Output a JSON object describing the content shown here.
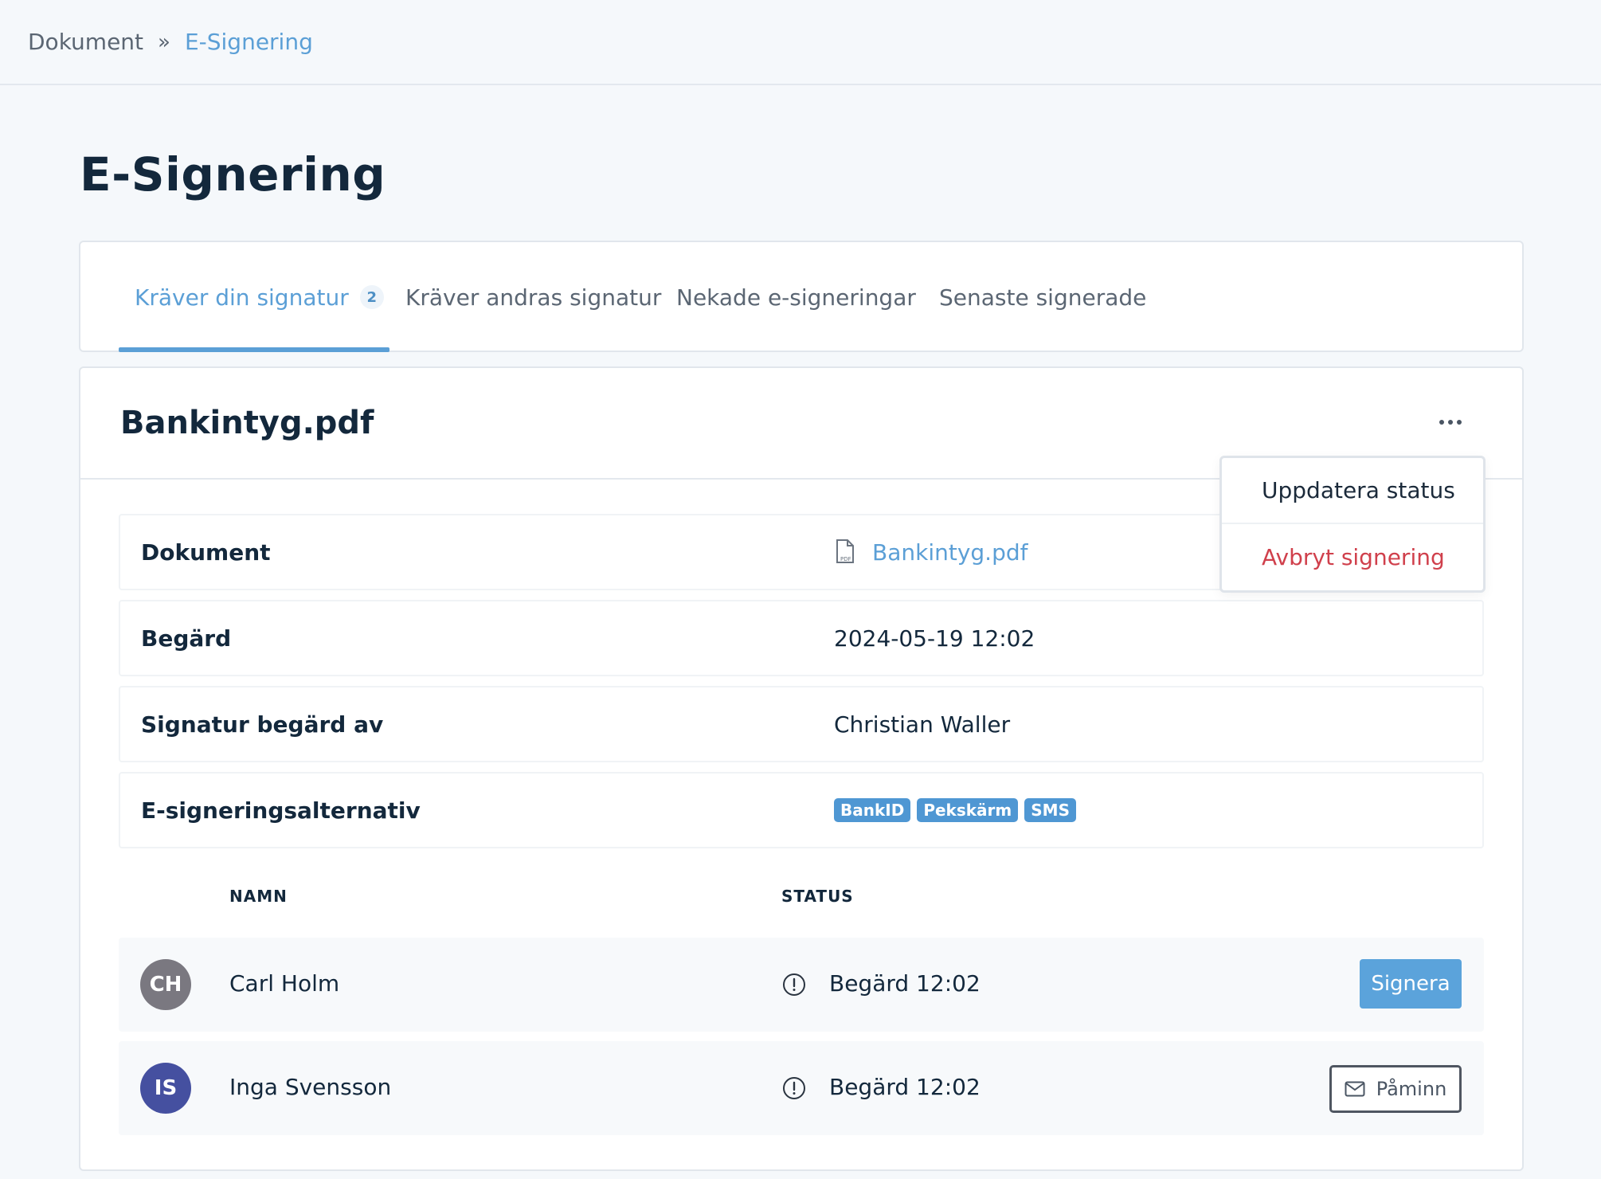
{
  "breadcrumb": {
    "root": "Dokument",
    "separator": "»",
    "current": "E-Signering"
  },
  "page_title": "E-Signering",
  "tabs": [
    {
      "label": "Kräver din signatur",
      "badge": "2",
      "active": true
    },
    {
      "label": "Kräver andras signatur",
      "active": false
    },
    {
      "label": "Nekade e-signeringar",
      "active": false
    },
    {
      "label": "Senaste signerade",
      "active": false
    }
  ],
  "document": {
    "title": "Bankintyg.pdf",
    "menu": {
      "update_status": "Uppdatera status",
      "cancel_signing": "Avbryt signering"
    },
    "details": {
      "document_label": "Dokument",
      "document_file": "Bankintyg.pdf",
      "requested_label": "Begärd",
      "requested_value": "2024-05-19 12:02",
      "requested_by_label": "Signatur begärd av",
      "requested_by_value": "Christian Waller",
      "options_label": "E-signeringsalternativ",
      "options": [
        "BankID",
        "Pekskärm",
        "SMS"
      ]
    }
  },
  "signers_table": {
    "headers": {
      "name": "NAMN",
      "status": "STATUS"
    },
    "rows": [
      {
        "initials": "CH",
        "name": "Carl Holm",
        "status": "Begärd 12:02",
        "action": "Signera",
        "avatar_color": "#7a7880"
      },
      {
        "initials": "IS",
        "name": "Inga Svensson",
        "status": "Begärd 12:02",
        "action": "Påminn",
        "avatar_color": "#4550a0"
      }
    ]
  },
  "colors": {
    "accent": "#5b9fd6",
    "danger": "#d0404c",
    "tag": "#4f97d3"
  }
}
